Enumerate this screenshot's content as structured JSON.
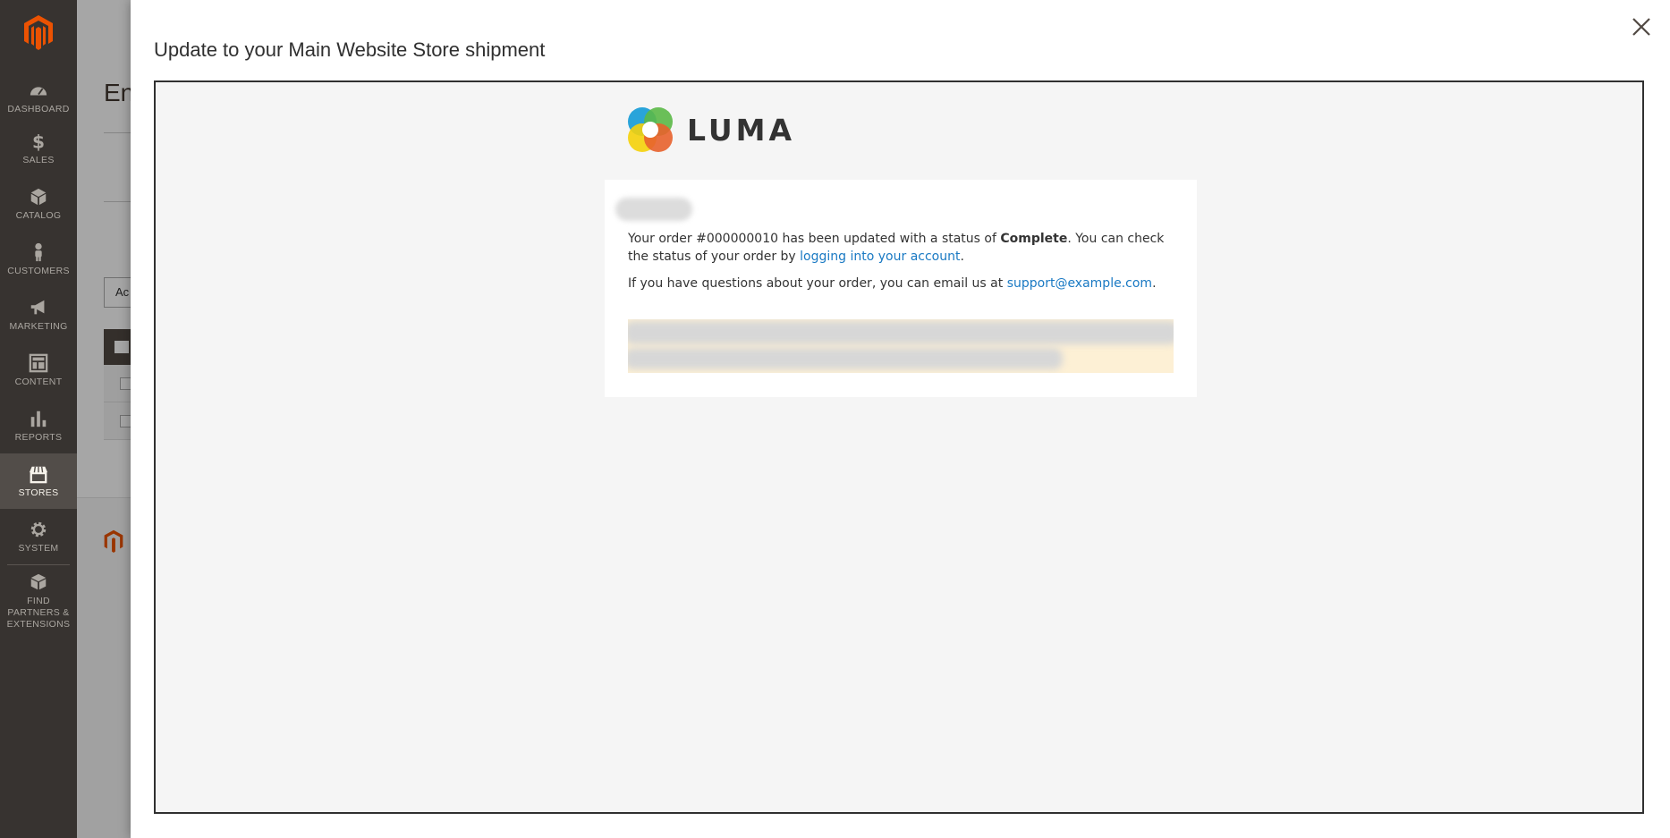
{
  "sidebar": {
    "items": [
      {
        "label": "DASHBOARD",
        "icon": "dashboard-icon"
      },
      {
        "label": "SALES",
        "icon": "dollar-icon"
      },
      {
        "label": "CATALOG",
        "icon": "box-icon"
      },
      {
        "label": "CUSTOMERS",
        "icon": "person-icon"
      },
      {
        "label": "MARKETING",
        "icon": "megaphone-icon"
      },
      {
        "label": "CONTENT",
        "icon": "layout-icon"
      },
      {
        "label": "REPORTS",
        "icon": "bar-chart-icon"
      },
      {
        "label": "STORES",
        "icon": "store-icon"
      },
      {
        "label": "SYSTEM",
        "icon": "gear-icon"
      },
      {
        "label": "FIND PARTNERS & EXTENSIONS",
        "icon": "extensions-icon"
      }
    ],
    "active": "STORES"
  },
  "background": {
    "title_fragment": "En",
    "select_fragment": "Ac"
  },
  "modal": {
    "title": "Update to your Main Website Store shipment"
  },
  "email": {
    "brand": "LUMA",
    "line1_pre": "Your order #000000010 has been updated with a status of ",
    "line1_status": "Complete",
    "line1_mid": ". You can check the status of your order by ",
    "line1_link": "logging into your account",
    "line1_end": ".",
    "line2_pre": "If you have questions about your order, you can email us at ",
    "line2_link": "support@example.com",
    "line2_end": "."
  },
  "colors": {
    "sidebar_bg": "#373330",
    "brand_orange": "#eb5202",
    "link_blue": "#1979c3",
    "note_bg": "#fdf0d5"
  }
}
